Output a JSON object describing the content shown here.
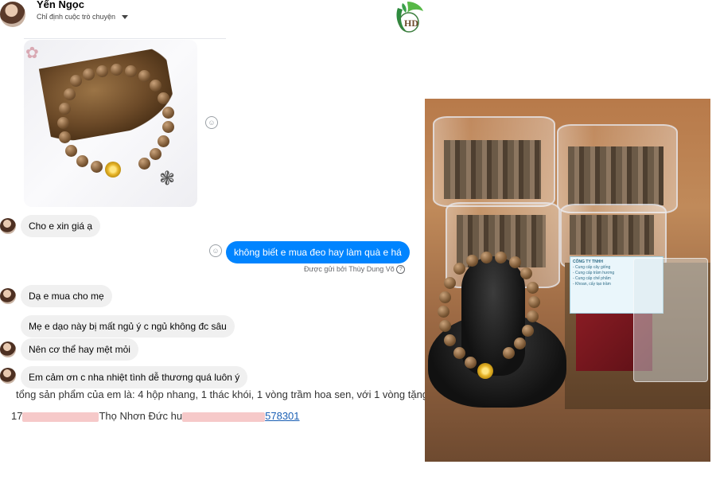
{
  "header": {
    "contact_name": "Yến Ngọc",
    "subtitle": "Chỉ định cuộc trò chuyện"
  },
  "messages": {
    "m1": "Cho e xin giá ạ",
    "m2": "không biết e mua đeo hay làm quà e há",
    "sent_by": "Được gửi bởi Thùy Dung Võ",
    "m3": "Dạ e mua cho mẹ",
    "m4": "Mẹ e dạo này bị mất ngủ ý c ngủ không đc sâu",
    "m5": "Nên cơ thể hay mệt mỏi",
    "m6": "Em cảm ơn c nha nhiệt tình dễ thương quá luôn ý"
  },
  "order": {
    "summary": "tổng sản phẩm của em là: 4 hộp nhang, 1 thác khói, 1 vòng trầm hoa sen, với 1 vòng tặng",
    "address_prefix": "17",
    "address_mid": "Thọ Nhơn Đức hu",
    "phone_suffix": "578301"
  },
  "logo": {
    "text": "HD"
  },
  "card": {
    "title": "CÔNG TY TNHH",
    "lines": [
      "- Cung cấp cây giống",
      "- Cung cấp trầm hương",
      "- Cung cấp chế phẩm",
      "- Khoan, cấy tạo trầm"
    ]
  },
  "colors": {
    "outgoing_bubble": "#0084ff",
    "incoming_bubble": "#f0f0f0",
    "link": "#1a5fb4"
  }
}
